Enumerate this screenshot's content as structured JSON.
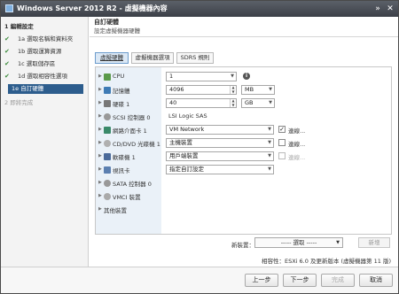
{
  "window": {
    "title": "Windows Server 2012 R2 - 虛擬機器內容",
    "close_glyph": "✕",
    "min_glyph": "»"
  },
  "steps": [
    {
      "num": "1",
      "label": "編輯設定",
      "done": false,
      "level": "main"
    },
    {
      "num": "1a",
      "label": "選取名稱和資料夾",
      "done": true,
      "level": "sub"
    },
    {
      "num": "1b",
      "label": "選取運算資源",
      "done": true,
      "level": "sub"
    },
    {
      "num": "1c",
      "label": "選取儲存區",
      "done": true,
      "level": "sub"
    },
    {
      "num": "1d",
      "label": "選取相容性選項",
      "done": true,
      "level": "sub"
    },
    {
      "num": "1e",
      "label": "自訂硬體",
      "done": false,
      "level": "active"
    },
    {
      "num": "2",
      "label": "即將完成",
      "done": false,
      "level": "dim"
    }
  ],
  "page": {
    "title": "自訂硬體",
    "subtitle": "設定虛擬機器硬體"
  },
  "tabs": [
    {
      "label": "虛擬硬體",
      "selected": true
    },
    {
      "label": "虛擬機器選項",
      "selected": false
    },
    {
      "label": "SDRS 規則",
      "selected": false
    }
  ],
  "hardware": {
    "cpu": {
      "label": "CPU",
      "value": "1"
    },
    "memory": {
      "label": "記憶體",
      "value": "4096",
      "unit": "MB"
    },
    "disk": {
      "label": "硬碟 1",
      "value": "40",
      "unit": "GB"
    },
    "scsi": {
      "label": "SCSI 控制器 0",
      "value": "LSI Logic SAS"
    },
    "nic": {
      "label": "網路介面卡 1",
      "value": "VM Network",
      "connect_label": "連線...",
      "checked": true
    },
    "cdrom": {
      "label": "CD/DVD 光碟機 1",
      "value": "主機裝置",
      "connect_label": "連線...",
      "checked": false
    },
    "floppy": {
      "label": "軟碟機 1",
      "value": "用戶端裝置",
      "connect_label": "連線...",
      "checked": false
    },
    "video": {
      "label": "視訊卡",
      "value": "指定自訂設定"
    },
    "sata": {
      "label": "SATA 控制器 0"
    },
    "vmci": {
      "label": "VMCI 裝置"
    },
    "other": {
      "label": "其他裝置"
    }
  },
  "new_device": {
    "label": "新裝置：",
    "placeholder": "----- 選取 -----",
    "add_label": "新增"
  },
  "compat": "相容性：ESXi 6.0 及更新版本 (虛擬機器第 11 版)",
  "footer": {
    "back": "上一步",
    "next": "下一步",
    "finish": "完成",
    "cancel": "取消"
  },
  "colors": {
    "accent": "#2d5d8d",
    "titlebar": "#4a4f57",
    "panel_left": "#eaf1f8"
  }
}
